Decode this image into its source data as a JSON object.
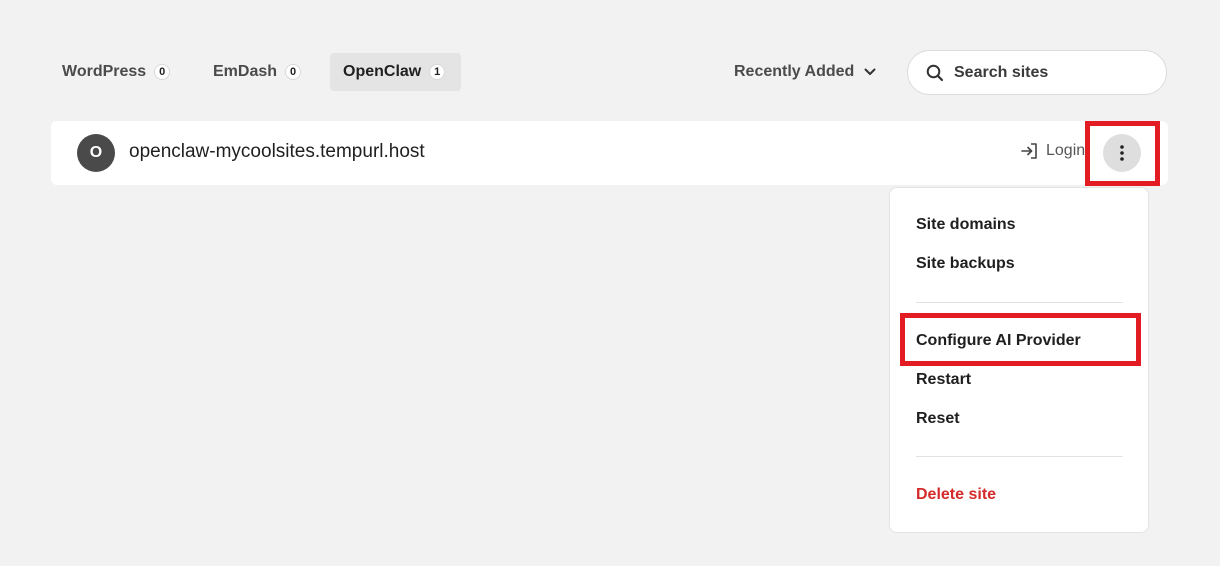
{
  "tabs": [
    {
      "label": "WordPress",
      "count": "0",
      "active": false
    },
    {
      "label": "EmDash",
      "count": "0",
      "active": false
    },
    {
      "label": "OpenClaw",
      "count": "1",
      "active": true
    }
  ],
  "sort": {
    "label": "Recently Added",
    "icon": "chevron-down-icon"
  },
  "search": {
    "placeholder": "Search sites",
    "value": "",
    "icon": "search-icon"
  },
  "site": {
    "avatar_letter": "O",
    "name": "openclaw-mycoolsites.tempurl.host",
    "login_label": "Login",
    "login_icon": "login-icon",
    "menu_icon": "more-vertical-icon"
  },
  "menu": {
    "items": [
      {
        "label": "Site domains"
      },
      {
        "label": "Site backups"
      },
      {
        "label": "Configure AI Provider"
      },
      {
        "label": "Restart"
      },
      {
        "label": "Reset"
      },
      {
        "label": "Delete site"
      }
    ]
  },
  "colors": {
    "background": "#f2f2f2",
    "highlight": "#e31b23",
    "danger": "#d42a2a",
    "avatar": "#4a4a4a"
  }
}
